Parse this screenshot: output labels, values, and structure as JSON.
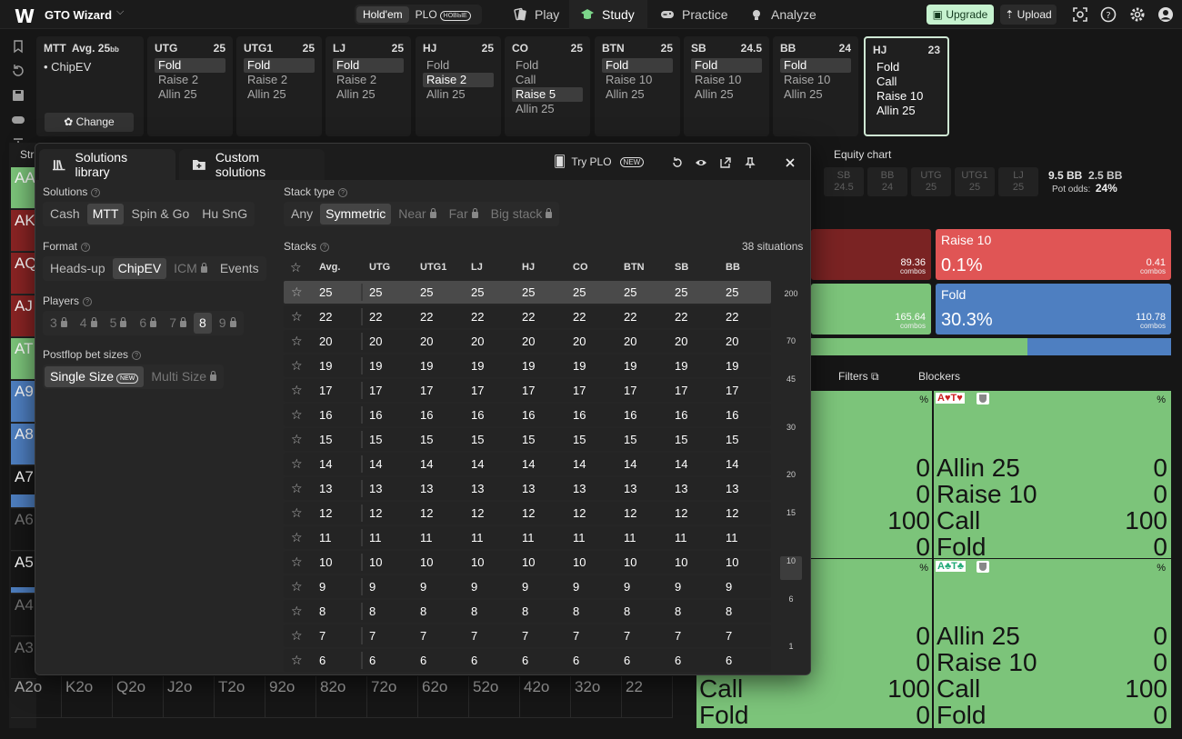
{
  "topbar": {
    "logo": "W",
    "brand": "GTO Wizard",
    "game_toggle": [
      {
        "label": "Hold'em",
        "active": true
      },
      {
        "label": "PLO",
        "badge": "НОВЫЕ"
      }
    ],
    "nav": [
      {
        "label": "Play",
        "icon": "cards-icon"
      },
      {
        "label": "Study",
        "icon": "mortarboard-icon",
        "active": true
      },
      {
        "label": "Practice",
        "icon": "gamepad-icon"
      },
      {
        "label": "Analyze",
        "icon": "lightbulb-icon"
      }
    ],
    "upgrade": "Upgrade",
    "upload": "Upload"
  },
  "mtt_card": {
    "title": "MTT",
    "avg_label": "Avg. 25",
    "avg_unit": "bb",
    "mode": "ChipEV",
    "change": "Change"
  },
  "positions": [
    {
      "name": "UTG",
      "stack": "25",
      "actions": [
        "Fold",
        "Raise 2",
        "Allin 25"
      ],
      "selected": 0
    },
    {
      "name": "UTG1",
      "stack": "25",
      "actions": [
        "Fold",
        "Raise 2",
        "Allin 25"
      ],
      "selected": 0
    },
    {
      "name": "LJ",
      "stack": "25",
      "actions": [
        "Fold",
        "Raise 2",
        "Allin 25"
      ],
      "selected": 0
    },
    {
      "name": "HJ",
      "stack": "25",
      "actions": [
        "Fold",
        "Raise 2",
        "Allin 25"
      ],
      "selected": 1
    },
    {
      "name": "CO",
      "stack": "25",
      "actions": [
        "Fold",
        "Call",
        "Raise 5",
        "Allin 25"
      ],
      "selected": 2
    },
    {
      "name": "BTN",
      "stack": "25",
      "actions": [
        "Fold",
        "Raise 10",
        "Allin 25"
      ],
      "selected": 0
    },
    {
      "name": "SB",
      "stack": "24.5",
      "actions": [
        "Fold",
        "Raise 10",
        "Allin 25"
      ],
      "selected": 0
    },
    {
      "name": "BB",
      "stack": "24",
      "actions": [
        "Fold",
        "Raise 10",
        "Allin 25"
      ],
      "selected": 0
    },
    {
      "name": "HJ",
      "stack": "23",
      "actions": [
        "Fold",
        "Call",
        "Raise 10",
        "Allin 25"
      ],
      "selected": -1,
      "current": true
    }
  ],
  "background": {
    "strategy_tab": "Str",
    "left_hands": [
      "AA",
      "AK",
      "AQ",
      "AJ",
      "AT",
      "A9",
      "A8",
      "A7",
      "A6",
      "A5",
      "A4",
      "A3"
    ],
    "bottom_row": [
      "A2o",
      "K2o",
      "Q2o",
      "J2o",
      "T2o",
      "92o",
      "82o",
      "72o",
      "62o",
      "52o",
      "42o",
      "32o",
      "22"
    ],
    "equity_chart": "Equity chart",
    "mini_positions": [
      {
        "n": "SB",
        "v": "24.5"
      },
      {
        "n": "BB",
        "v": "24"
      },
      {
        "n": "UTG",
        "v": "25"
      },
      {
        "n": "UTG1",
        "v": "25"
      },
      {
        "n": "LJ",
        "v": "25"
      }
    ],
    "pot": "9.5 BB",
    "stack_val": "2.5 BB",
    "pot_odds_label": "Pot odds:",
    "pot_odds": "24%",
    "action_boxes": [
      {
        "label": "",
        "pct": "",
        "combos": "89.36",
        "color": "#7a2323"
      },
      {
        "label": "Raise 10",
        "pct": "0.1%",
        "combos": "0.41",
        "color": "#e05555"
      },
      {
        "label": "",
        "pct": "",
        "combos": "165.64",
        "color": "#7cc47a"
      },
      {
        "label": "Fold",
        "pct": "30.3%",
        "combos": "110.78",
        "color": "#4e7fc1"
      }
    ],
    "combos_label": "combos",
    "filters": "Filters",
    "blockers": "Blockers",
    "hand_a": "A♥T♥",
    "hand_b": "A♣T♣",
    "pct_sign": "%",
    "cells": {
      "tl": [
        "0",
        "0",
        "100",
        "0"
      ],
      "tr": [
        {
          "a": "Allin 25",
          "v": "0"
        },
        {
          "a": "Raise 10",
          "v": "0"
        },
        {
          "a": "Call",
          "v": "100"
        },
        {
          "a": "Fold",
          "v": "0"
        }
      ],
      "bl": [
        {
          "a": "Call",
          "v": "100"
        },
        {
          "a": "Fold",
          "v": "0"
        }
      ],
      "blv": [
        "0",
        "0"
      ],
      "br": [
        {
          "a": "Allin 25",
          "v": "0"
        },
        {
          "a": "Raise 10",
          "v": "0"
        },
        {
          "a": "Call",
          "v": "100"
        },
        {
          "a": "Fold",
          "v": "0"
        }
      ]
    }
  },
  "modal": {
    "tabs": [
      "Solutions library",
      "Custom solutions"
    ],
    "try_plo": "Try PLO",
    "new": "NEW",
    "solutions_label": "Solutions",
    "solutions": [
      "Cash",
      "MTT",
      "Spin & Go",
      "Hu SnG"
    ],
    "solutions_active": 1,
    "format_label": "Format",
    "formats": [
      {
        "l": "Heads-up"
      },
      {
        "l": "ChipEV",
        "on": true
      },
      {
        "l": "ICM",
        "lock": true
      },
      {
        "l": "Events"
      }
    ],
    "players_label": "Players",
    "players": [
      {
        "l": "3",
        "lock": true
      },
      {
        "l": "4",
        "lock": true
      },
      {
        "l": "5",
        "lock": true
      },
      {
        "l": "6",
        "lock": true
      },
      {
        "l": "7",
        "lock": true
      },
      {
        "l": "8",
        "on": true
      },
      {
        "l": "9",
        "lock": true
      }
    ],
    "postflop_label": "Postflop bet sizes",
    "single_size": "Single Size",
    "multi_size": "Multi Size",
    "stack_type_label": "Stack type",
    "stack_types": [
      {
        "l": "Any"
      },
      {
        "l": "Symmetric",
        "on": true
      },
      {
        "l": "Near",
        "lock": true
      },
      {
        "l": "Far",
        "lock": true
      },
      {
        "l": "Big stack",
        "lock": true
      }
    ],
    "stacks_label": "Stacks",
    "situations": "38 situations",
    "columns": [
      "Avg.",
      "UTG",
      "UTG1",
      "LJ",
      "HJ",
      "CO",
      "BTN",
      "SB",
      "BB"
    ],
    "rows": [
      "25",
      "22",
      "20",
      "19",
      "17",
      "16",
      "15",
      "14",
      "13",
      "12",
      "11",
      "10",
      "9",
      "8",
      "7",
      "6"
    ],
    "scale": [
      "200",
      "70",
      "45",
      "30",
      "20",
      "15",
      "10",
      "6",
      "1"
    ]
  }
}
